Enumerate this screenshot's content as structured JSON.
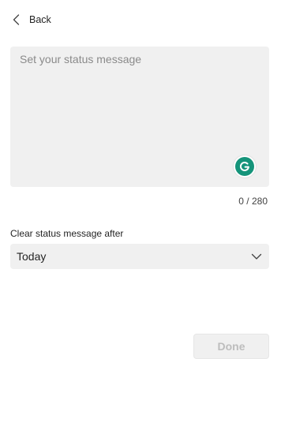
{
  "header": {
    "back_label": "Back",
    "back_icon": "chevron-left-icon"
  },
  "status_message": {
    "placeholder": "Set your status message",
    "value": "",
    "counter": "0 / 280",
    "grammarly_icon": "grammarly-icon",
    "grammarly_color": "#15947a"
  },
  "clear_after": {
    "label": "Clear status message after",
    "selected": "Today",
    "dropdown_icon": "chevron-down-icon"
  },
  "actions": {
    "done_label": "Done",
    "done_enabled": false
  }
}
